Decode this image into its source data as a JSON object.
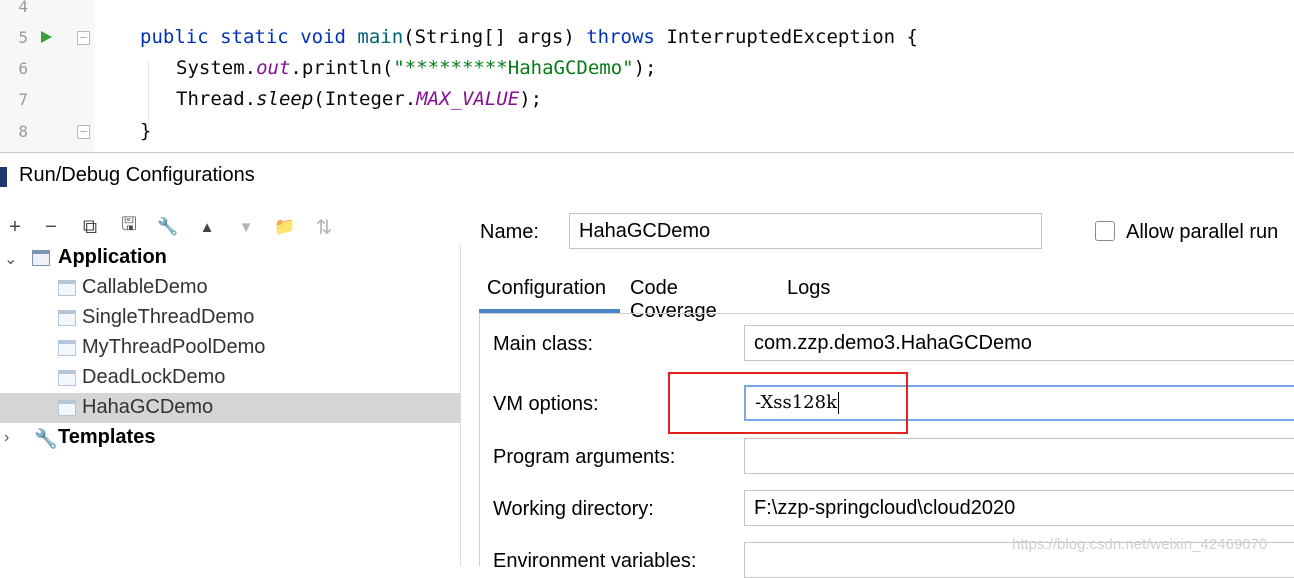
{
  "editor": {
    "lines": [
      {
        "num": "4"
      },
      {
        "num": "5"
      },
      {
        "num": "6"
      },
      {
        "num": "7"
      },
      {
        "num": "8"
      }
    ],
    "code": {
      "l5_public": "public",
      "l5_static": "static",
      "l5_void": "void",
      "l5_main": "main",
      "l5_sig": "(String[] args)",
      "l5_throws": "throws",
      "l5_exc": "InterruptedException {",
      "l6_sys": "System.",
      "l6_out": "out",
      "l6_println": ".println(",
      "l6_str": "\"*********HahaGCDemo\"",
      "l6_end": ");",
      "l7_thread": "Thread.",
      "l7_sleep": "sleep",
      "l7_int": "(Integer.",
      "l7_max": "MAX_VALUE",
      "l7_end": ");",
      "l8_brace": "}"
    }
  },
  "dialog": {
    "title": "Run/Debug Configurations",
    "toolbar": [
      {
        "name": "add-icon",
        "glyph": "+"
      },
      {
        "name": "remove-icon",
        "glyph": "−"
      },
      {
        "name": "copy-icon",
        "glyph": "⧉"
      },
      {
        "name": "save-icon",
        "glyph": "🖫"
      },
      {
        "name": "wrench-icon",
        "glyph": "🔧"
      },
      {
        "name": "move-up-icon",
        "glyph": "▲"
      },
      {
        "name": "move-down-icon",
        "glyph": "▼"
      },
      {
        "name": "folder-add-icon",
        "glyph": "📁"
      },
      {
        "name": "sort-icon",
        "glyph": "⇅"
      }
    ],
    "tree": {
      "application": "Application",
      "items": [
        "CallableDemo",
        "SingleThreadDemo",
        "MyThreadPoolDemo",
        "DeadLockDemo",
        "HahaGCDemo"
      ],
      "templates": "Templates"
    },
    "name_label": "Name:",
    "name_value": "HahaGCDemo",
    "allow_parallel": "Allow parallel run",
    "tabs": [
      "Configuration",
      "Code Coverage",
      "Logs"
    ],
    "form": {
      "main_class_label": "Main class:",
      "main_class_value": "com.zzp.demo3.HahaGCDemo",
      "vm_options_label": "VM options:",
      "vm_options_value": "-Xss128k",
      "program_args_label": "Program arguments:",
      "program_args_value": "",
      "working_dir_label": "Working directory:",
      "working_dir_value": "F:\\zzp-springcloud\\cloud2020",
      "env_vars_label": "Environment variables:"
    }
  },
  "watermark": "https://blog.csdn.net/weixin_42469070",
  "colors": {
    "accent": "#4a86c8",
    "annotation": "#e0221c",
    "keyword": "#0033b3",
    "string": "#067d17"
  }
}
